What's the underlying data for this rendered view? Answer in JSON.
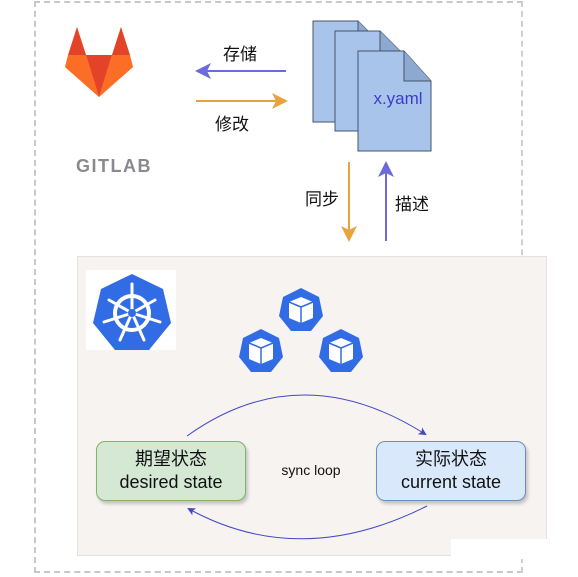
{
  "gitlab": {
    "label": "GITLAB"
  },
  "arrows": {
    "store": "存储",
    "modify": "修改",
    "sync": "同步",
    "describe": "描述"
  },
  "file": {
    "name": "x.yaml"
  },
  "loop": {
    "label": "sync loop",
    "desired": {
      "cn": "期望状态",
      "en": "desired state"
    },
    "current": {
      "cn": "实际状态",
      "en": "current state"
    }
  },
  "colors": {
    "blue_arrow": "#6b6bdc",
    "orange_arrow": "#e8a33d",
    "k8s_blue": "#326ce5",
    "doc_fill": "#a9c4eb"
  }
}
